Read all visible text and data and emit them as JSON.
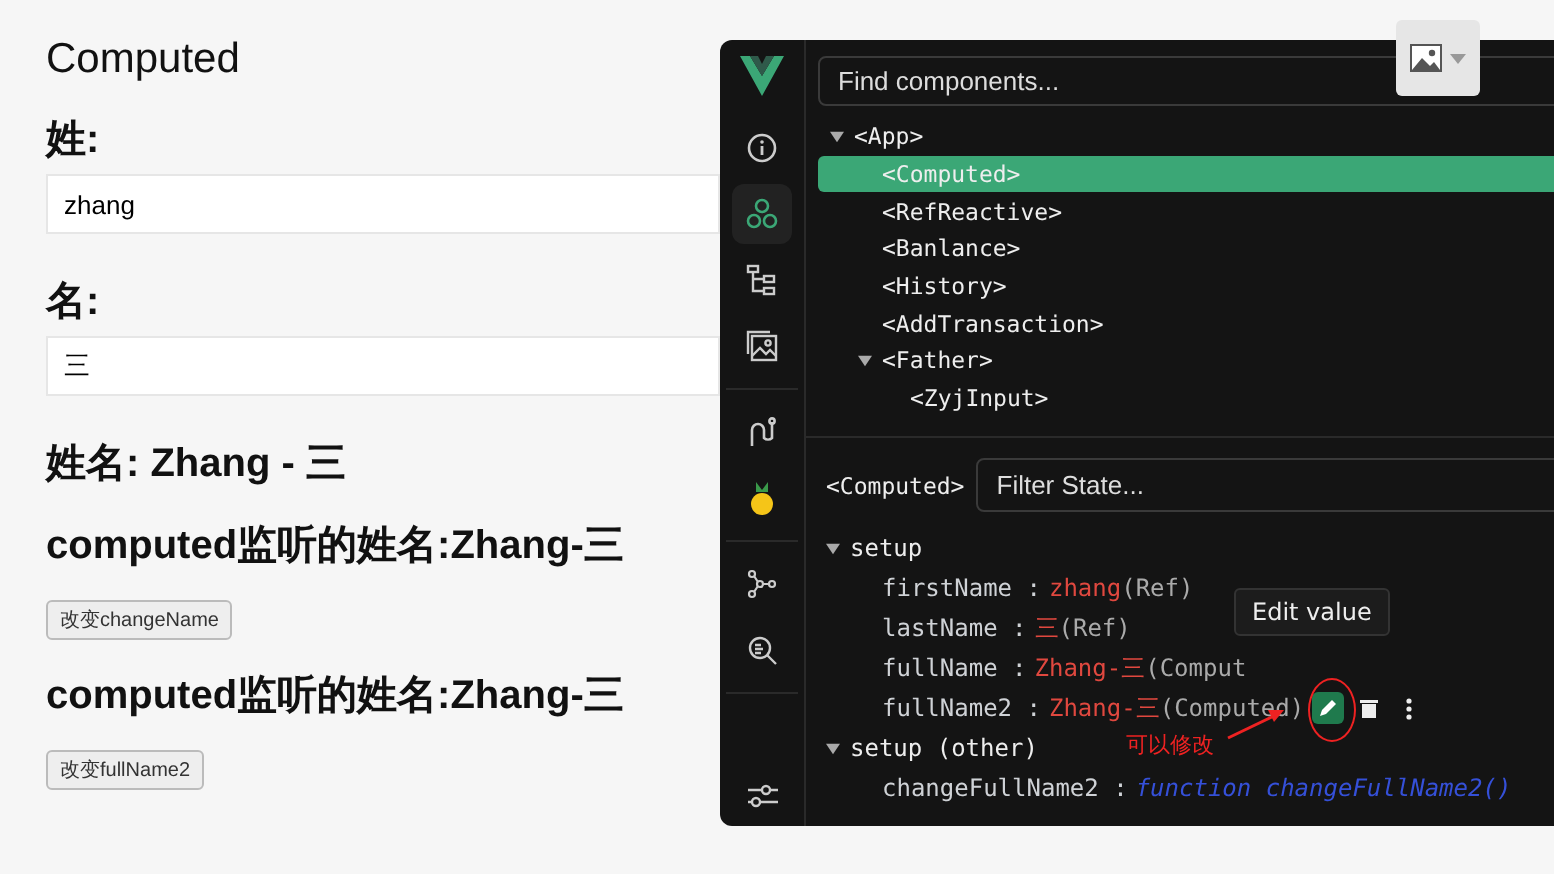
{
  "page": {
    "title": "Computed",
    "blocks": [
      {
        "kind": "label",
        "text": "姓:"
      },
      {
        "kind": "input",
        "value": "zhang"
      },
      {
        "kind": "label",
        "text": "名:"
      },
      {
        "kind": "input",
        "value": "三"
      },
      {
        "kind": "heading",
        "text": "姓名: Zhang - 三"
      },
      {
        "kind": "heading",
        "text": "computed监听的姓名:Zhang-三"
      },
      {
        "kind": "button",
        "text": "改变changeName"
      },
      {
        "kind": "heading",
        "text": "computed监听的姓名:Zhang-三"
      },
      {
        "kind": "button",
        "text": "改变fullName2"
      }
    ]
  },
  "devtools": {
    "rail": [
      {
        "kind": "info",
        "selected": false
      },
      {
        "kind": "components",
        "selected": true
      },
      {
        "kind": "tree",
        "selected": false
      },
      {
        "kind": "image",
        "selected": false
      },
      {
        "kind": "route",
        "selected": false
      },
      {
        "kind": "pinia",
        "selected": false
      },
      {
        "kind": "graph",
        "selected": false
      },
      {
        "kind": "inspect",
        "selected": false
      },
      {
        "kind": "settings",
        "selected": false
      }
    ],
    "search": {
      "placeholder": "Find components..."
    },
    "tree": [
      {
        "label": "<App>",
        "selected": false,
        "expanded": true,
        "children": [
          {
            "label": "<Computed>",
            "selected": true
          },
          {
            "label": "<RefReactive>",
            "selected": false
          },
          {
            "label": "<Banlance>",
            "selected": false
          },
          {
            "label": "<History>",
            "selected": false
          },
          {
            "label": "<AddTransaction>",
            "selected": false
          },
          {
            "label": "<Father>",
            "selected": false,
            "expanded": true,
            "children": [
              {
                "label": "<ZyjInput>",
                "selected": false
              }
            ]
          }
        ]
      }
    ],
    "state": {
      "component": "<Computed>",
      "filter": {
        "placeholder": "Filter State..."
      },
      "groups": [
        {
          "label": "setup",
          "expanded": true,
          "props": [
            {
              "key": "firstName :",
              "value": "zhang",
              "type": "(Ref)"
            },
            {
              "key": "lastName :",
              "value": "三",
              "type": "(Ref)"
            },
            {
              "key": "fullName :",
              "value": "Zhang-三",
              "type": "(Comput"
            },
            {
              "key": "fullName2 :",
              "value": "Zhang-三",
              "type": "(Computed)",
              "actions": true
            }
          ]
        },
        {
          "label": "setup (other)",
          "expanded": true,
          "props": [
            {
              "key": "changeFullName2 :",
              "value": "function changeFullName2()",
              "kind": "function"
            }
          ]
        }
      ]
    },
    "tooltip": "Edit value",
    "annotation": "可以修改"
  }
}
